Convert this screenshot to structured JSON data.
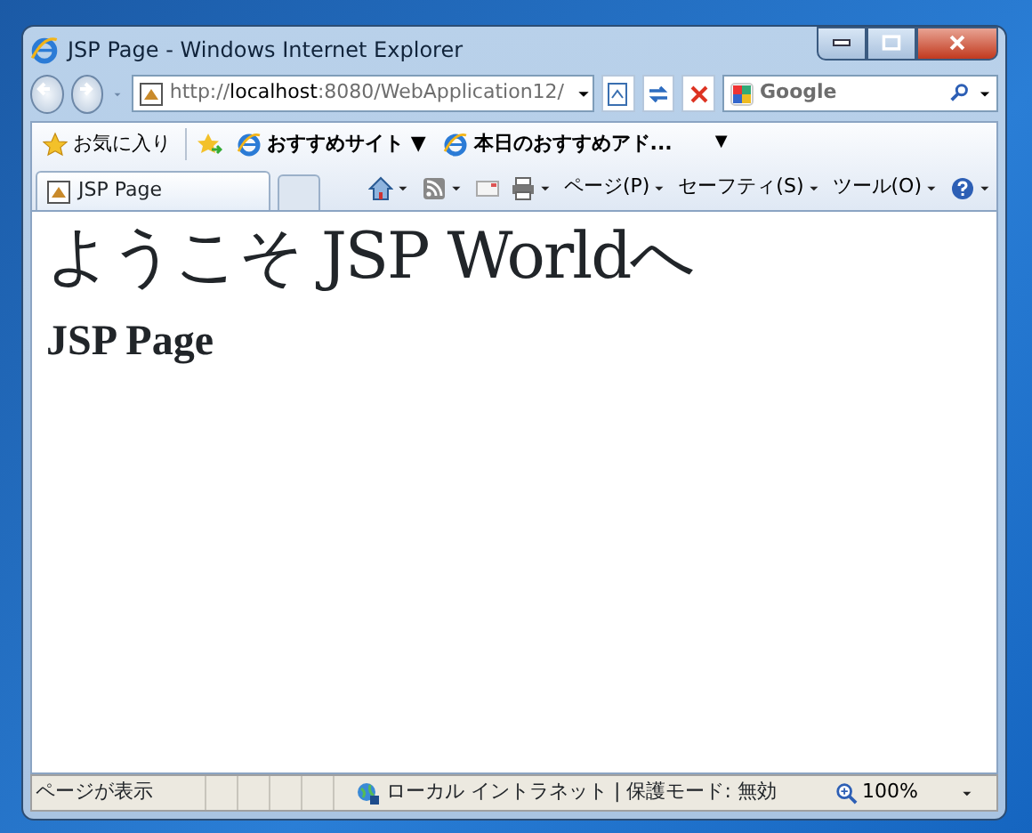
{
  "window": {
    "title": "JSP Page - Windows Internet Explorer"
  },
  "address_bar": {
    "url": "http://**localhost**:8080/WebApplication12/"
  },
  "search": {
    "placeholder": "Google"
  },
  "favorites_bar": {
    "favorites_label": "お気に入り",
    "links": [
      {
        "label": "おすすめサイト ▼"
      },
      {
        "label": "本日のおすすめアド...",
        "caret": "▼"
      }
    ]
  },
  "tabs": [
    {
      "label": "JSP Page",
      "selected": true
    }
  ],
  "command_bar": [
    {
      "kind": "home"
    },
    {
      "kind": "feed"
    },
    {
      "kind": "mail"
    },
    {
      "kind": "print"
    },
    {
      "kind": "menu",
      "label": "ページ(P)"
    },
    {
      "kind": "menu",
      "label": "セーフティ(S)"
    },
    {
      "kind": "menu",
      "label": "ツール(O)"
    },
    {
      "kind": "help"
    }
  ],
  "page": {
    "heading": "ようこそ JSP Worldへ",
    "subheading": "JSP Page"
  },
  "status_bar": {
    "message": "ページが表示",
    "zone": "ローカル イントラネット | 保護モード: 無効",
    "zoom": "100%"
  }
}
